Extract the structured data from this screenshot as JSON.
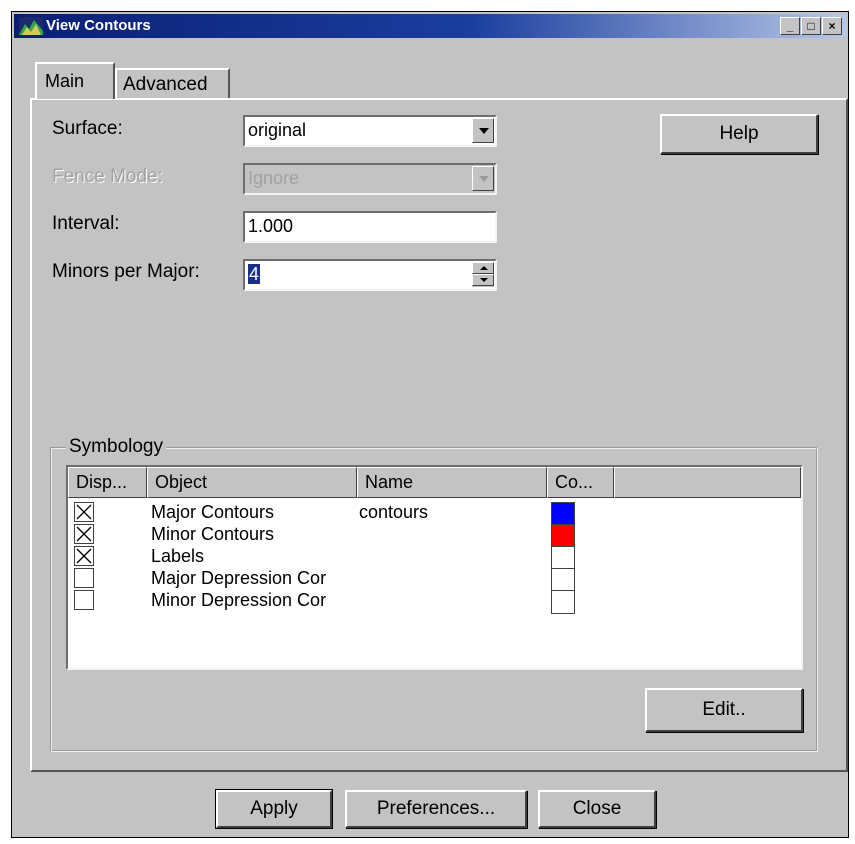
{
  "window": {
    "title": "View Contours"
  },
  "tabs": [
    {
      "label": "Main"
    },
    {
      "label": "Advanced"
    }
  ],
  "form": {
    "surface_label": "Surface:",
    "surface_value": "original",
    "fence_mode_label": "Fence Mode:",
    "fence_mode_value": "Ignore",
    "interval_label": "Interval:",
    "interval_value": "1.000",
    "minors_label": "Minors per Major:",
    "minors_value": "4"
  },
  "help_button": "Help",
  "symbology": {
    "title": "Symbology",
    "columns": [
      "Disp...",
      "Object",
      "Name",
      "Co..."
    ],
    "rows": [
      {
        "checked": true,
        "object": "Major Contours",
        "name": "contours",
        "color": "#0000ff"
      },
      {
        "checked": true,
        "object": "Minor Contours",
        "name": "",
        "color": "#ff0000"
      },
      {
        "checked": true,
        "object": "Labels",
        "name": "",
        "color": "#ffffff"
      },
      {
        "checked": false,
        "object": "Major Depression Cor",
        "name": "",
        "color": "#ffffff"
      },
      {
        "checked": false,
        "object": "Minor Depression Cor",
        "name": "",
        "color": "#ffffff"
      }
    ],
    "edit_button": "Edit.."
  },
  "footer": {
    "apply": "Apply",
    "preferences": "Preferences...",
    "close": "Close"
  },
  "icons": {
    "app": "terrain-icon",
    "minimize": "minimize-icon",
    "maximize": "maximize-icon",
    "close": "close-icon",
    "dropdown": "chevron-down-icon",
    "spin_up": "spin-up-icon",
    "spin_down": "spin-down-icon"
  }
}
